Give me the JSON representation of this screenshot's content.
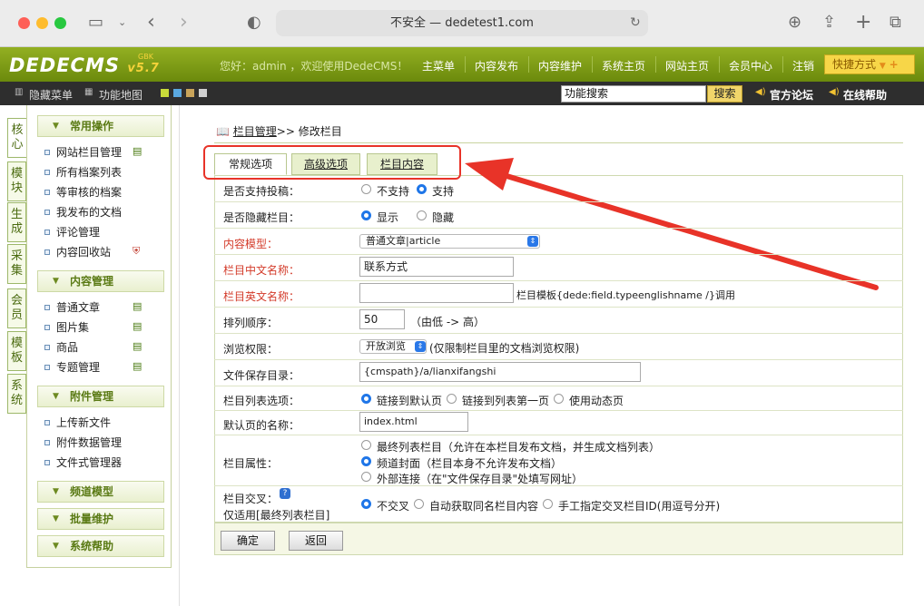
{
  "browser": {
    "address": "不安全 — dedetest1.com"
  },
  "header": {
    "logo": "DEDECMS",
    "logo_version": "v5.7",
    "logo_tag": "GBK",
    "welcome": "您好：admin ，欢迎使用DedeCMS！",
    "nav": [
      "主菜单",
      "内容发布",
      "内容维护",
      "系统主页",
      "网站主页",
      "会员中心",
      "注销"
    ],
    "quick": "快捷方式"
  },
  "toolbar": {
    "hide_menu": "隐藏菜单",
    "func_map": "功能地图",
    "search_placeholder": "功能搜索",
    "search_btn": "搜索",
    "forum": "官方论坛",
    "help": "在线帮助"
  },
  "left_tabs": [
    "核心",
    "模块",
    "生成",
    "采集",
    "会员",
    "模板",
    "系统"
  ],
  "sidebar": {
    "sections": [
      {
        "title": "常用操作",
        "items": [
          "网站栏目管理",
          "所有档案列表",
          "等审核的档案",
          "我发布的文档",
          "评论管理",
          "内容回收站"
        ]
      },
      {
        "title": "内容管理",
        "items": [
          "普通文章",
          "图片集",
          "商品",
          "专题管理"
        ]
      },
      {
        "title": "附件管理",
        "items": [
          "上传新文件",
          "附件数据管理",
          "文件式管理器"
        ]
      },
      {
        "title": "频道模型",
        "items": []
      },
      {
        "title": "批量维护",
        "items": []
      },
      {
        "title": "系统帮助",
        "items": []
      }
    ]
  },
  "main": {
    "breadcrumb_link": "栏目管理",
    "breadcrumb_rest": ">> 修改栏目",
    "tabs": [
      "常规选项",
      "高级选项",
      "栏目内容"
    ],
    "rows": {
      "r0": {
        "label": "是否支持投稿：",
        "opt1": "不支持",
        "opt2": "支持"
      },
      "r1": {
        "label": "是否隐藏栏目：",
        "opt1": "显示",
        "opt2": "隐藏"
      },
      "r2": {
        "label": "内容模型：",
        "value": "普通文章|article"
      },
      "r3": {
        "label": "栏目中文名称：",
        "value": "联系方式"
      },
      "r4": {
        "label": "栏目英文名称：",
        "value": "",
        "note": "栏目模板{dede:field.typeenglishname /}调用"
      },
      "r5": {
        "label": "排列顺序：",
        "value": "50",
        "note": "（由低 -> 高）"
      },
      "r6": {
        "label": "浏览权限：",
        "value": "开放浏览",
        "note": "(仅限制栏目里的文档浏览权限)"
      },
      "r7": {
        "label": "文件保存目录：",
        "value": "{cmspath}/a/lianxifangshi"
      },
      "r8": {
        "label": "栏目列表选项：",
        "opt1": "链接到默认页",
        "opt2": "链接到列表第一页",
        "opt3": "使用动态页"
      },
      "r9": {
        "label": "默认页的名称：",
        "value": "index.html"
      },
      "r10": {
        "label": "栏目属性：",
        "opt1": "最终列表栏目（允许在本栏目发布文档，并生成文档列表）",
        "opt2": "频道封面（栏目本身不允许发布文档）",
        "opt3": "外部连接（在\"文件保存目录\"处填写网址）"
      },
      "r11": {
        "label": "栏目交叉：",
        "label2": "仅适用[最终列表栏目]",
        "opt1": "不交叉",
        "opt2": "自动获取同名栏目内容",
        "opt3": "手工指定交叉栏目ID(用逗号分开)"
      }
    },
    "buttons": {
      "ok": "确定",
      "back": "返回"
    }
  },
  "colors": {
    "header_green": "#7f9c16",
    "annotation_red": "#e83328",
    "label_red": "#d33b2a"
  }
}
